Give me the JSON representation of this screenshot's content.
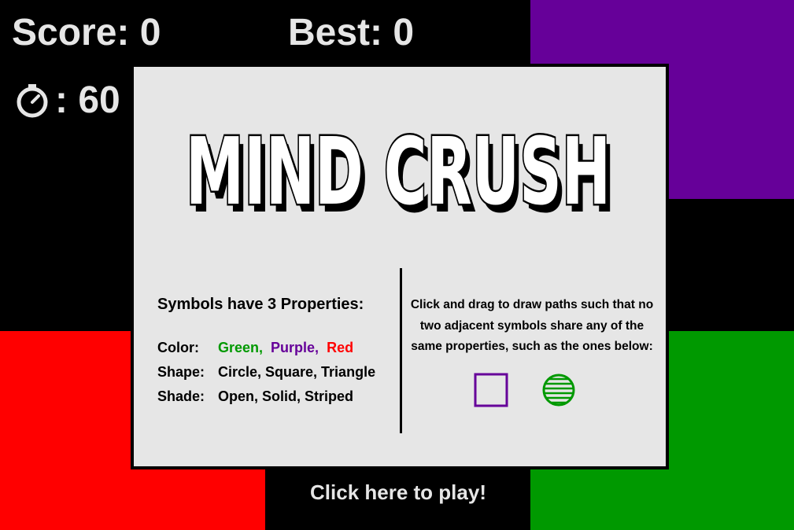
{
  "hud": {
    "score_text": "Score: 0",
    "best_text": "Best: 0",
    "timer_icon": "stopwatch-icon",
    "timer_text": ": 60"
  },
  "board_colors": {
    "purple": "#660099",
    "red": "#ff0000",
    "green": "#009900",
    "background": "#000000",
    "panel": "#e6e6e6"
  },
  "title": {
    "text": "MIND CRUSH"
  },
  "properties": {
    "heading": "Symbols have 3 Properties:",
    "color_label": "Color:",
    "color_values": [
      {
        "text": "Green,",
        "color": "#009900"
      },
      {
        "text": "Purple,",
        "color": "#660099"
      },
      {
        "text": "Red",
        "color": "#ff0000"
      }
    ],
    "shape_label": "Shape:",
    "shape_values": "Circle, Square, Triangle",
    "shade_label": "Shade:",
    "shade_values": "Open, Solid, Striped"
  },
  "instructions": {
    "text": "Click and drag to draw paths such that no two adjacent symbols share any of the same properties, such as the ones below:",
    "examples": [
      {
        "shape": "square",
        "shade": "open",
        "color": "#660099"
      },
      {
        "shape": "circle",
        "shade": "striped",
        "color": "#009900"
      }
    ]
  },
  "play": {
    "label": "Click here to play!"
  }
}
